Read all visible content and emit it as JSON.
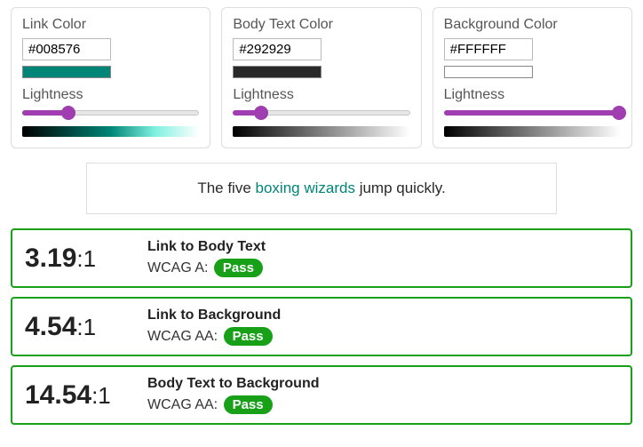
{
  "panels": [
    {
      "title": "Link Color",
      "hex": "#008576",
      "swatch": "#008576",
      "lightness_label": "Lightness",
      "lightness_pct": 26,
      "gradient": "linear-gradient(to right, #000000, #008576 50%, #7ff0e0 75%, #ffffff)"
    },
    {
      "title": "Body Text Color",
      "hex": "#292929",
      "swatch": "#292929",
      "lightness_label": "Lightness",
      "lightness_pct": 16,
      "gradient": "linear-gradient(to right, #000000, #808080, #ffffff)"
    },
    {
      "title": "Background Color",
      "hex": "#FFFFFF",
      "swatch": "#FFFFFF",
      "lightness_label": "Lightness",
      "lightness_pct": 99,
      "gradient": "linear-gradient(to right, #000000, #808080, #ffffff)"
    }
  ],
  "sample": {
    "pre": "The five ",
    "link": "boxing wizards",
    "post": " jump quickly.",
    "link_color": "#008576",
    "body_color": "#292929",
    "bg_color": "#FFFFFF"
  },
  "results": [
    {
      "ratio": "3.19",
      "suffix": ":1",
      "title": "Link to Body Text",
      "level_prefix": "WCAG A: ",
      "badge": "Pass"
    },
    {
      "ratio": "4.54",
      "suffix": ":1",
      "title": "Link to Background",
      "level_prefix": "WCAG AA: ",
      "badge": "Pass"
    },
    {
      "ratio": "14.54",
      "suffix": ":1",
      "title": "Body Text to Background",
      "level_prefix": "WCAG AA: ",
      "badge": "Pass"
    }
  ]
}
